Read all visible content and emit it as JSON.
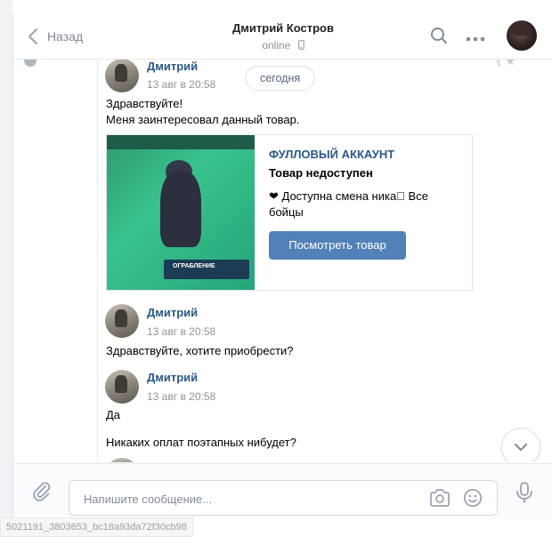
{
  "header": {
    "back_label": "Назад",
    "contact_name": "Дмитрий Костров",
    "status": "online"
  },
  "feed": {
    "date_divider": "сегодня",
    "messages": [
      {
        "author": "Дмитрий",
        "time": "13 авг в 20:58",
        "lines": [
          "Здравствуйте!",
          "Меня заинтересовал данный товар."
        ]
      },
      {
        "author": "Дмитрий",
        "time": "13 авг в 20:58",
        "lines": [
          "Здравствуйте, хотите приобрести?"
        ]
      },
      {
        "author": "Дмитрий",
        "time": "13 авг в 20:58",
        "lines": [
          "Да",
          "Никаких оплат поэтапных нибудет?"
        ]
      }
    ],
    "product_card": {
      "title": "ФУЛЛОВЫЙ АККАУНТ",
      "subtitle": "Товар недоступен",
      "description": "❤ Доступна смена ника⃣ Все бойцы",
      "button_label": "Посмотреть товар",
      "image_text": "ОГРАБЛЕНИЕ"
    }
  },
  "composer": {
    "placeholder": "Напишите сообщение..."
  },
  "footer_tag": "5021191_3803653_bc18a93da72f30cb98",
  "colors": {
    "accent": "#5181b8",
    "link": "#2a5885",
    "muted": "#939393"
  }
}
